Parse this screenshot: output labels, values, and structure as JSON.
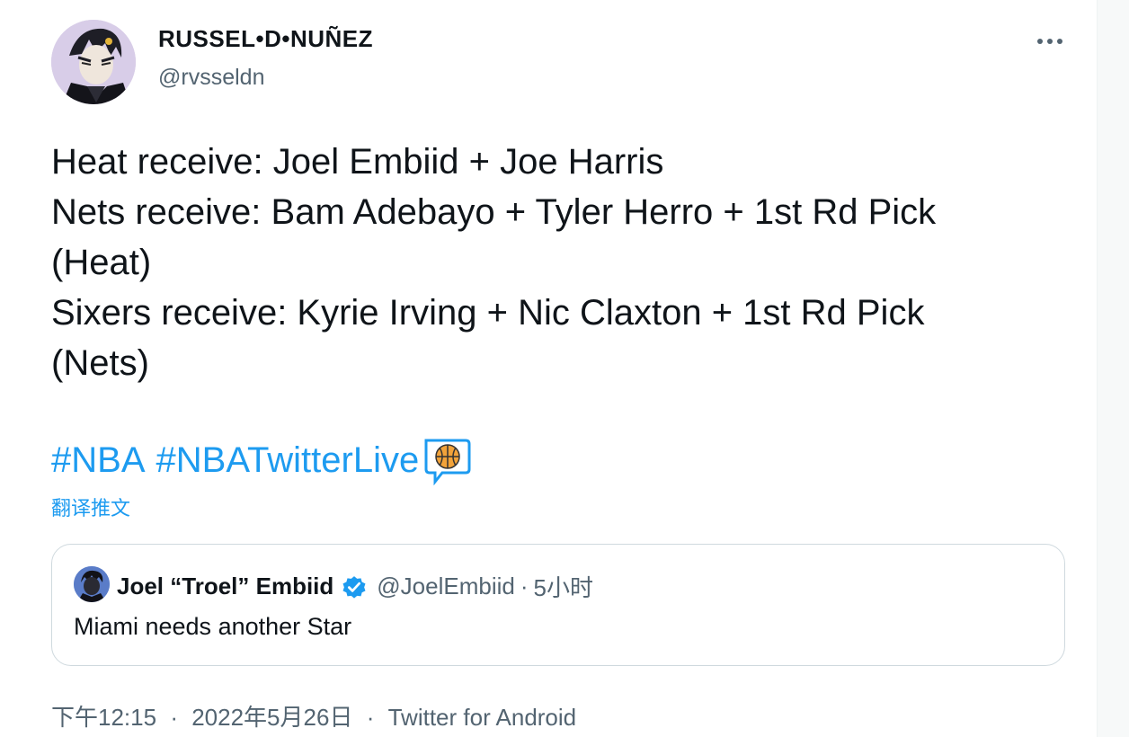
{
  "author": {
    "name": "RUSSEL•D•NUÑEZ",
    "handle": "@rvsseldn"
  },
  "tweet": {
    "lines": [
      "Heat receive: Joel Embiid + Joe Harris",
      "Nets receive: Bam Adebayo + Tyler Herro + 1st Rd Pick",
      "(Heat)",
      "Sixers receive: Kyrie Irving + Nic Claxton + 1st Rd Pick",
      "(Nets)"
    ],
    "hashtags": [
      "#NBA",
      "#NBATwitterLive"
    ],
    "translate_label": "翻译推文"
  },
  "quote": {
    "name": "Joel “Troel” Embiid",
    "handle": "@JoelEmbiid",
    "separator": "·",
    "time": "5小时",
    "text": "Miami needs another Star"
  },
  "footer": {
    "time": "下午12:15",
    "separator": "·",
    "date": "2022年5月26日",
    "source": "Twitter for Android"
  },
  "icons": {
    "more": "more-horizontal-icon",
    "hashflag": "basketball-speech-icon",
    "verified": "verified-badge-icon"
  },
  "colors": {
    "link": "#1d9bf0",
    "secondary_text": "#536471",
    "primary_text": "#0f1419",
    "border": "#cfd9de"
  }
}
